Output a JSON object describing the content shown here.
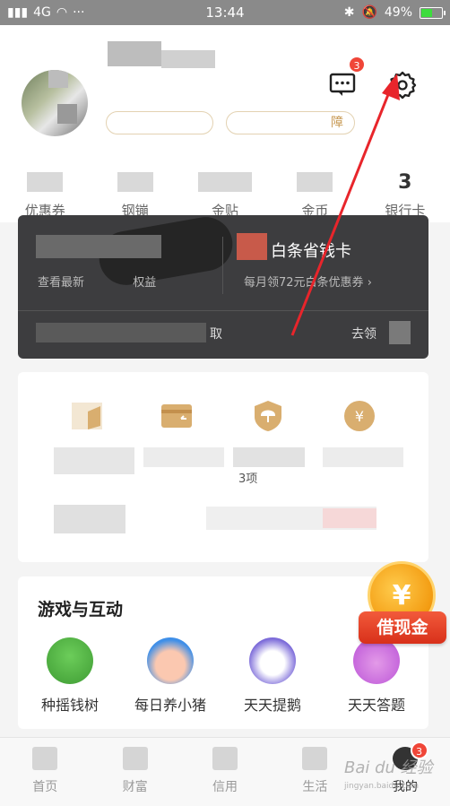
{
  "status_bar": {
    "signal": "4G",
    "more": "···",
    "time": "13:44",
    "battery": "49%",
    "battery_level": 0.49
  },
  "header": {
    "message_badge": "3",
    "assets": [
      {
        "label": "优惠券",
        "value": ""
      },
      {
        "label": "钢镚",
        "value": ""
      },
      {
        "label": "金贴",
        "value": ""
      },
      {
        "label": "金币",
        "value": ""
      },
      {
        "label": "银行卡",
        "value": "3"
      }
    ],
    "pill_right_text": "障"
  },
  "dark_card": {
    "left_sub": "查看最新",
    "left_sub_tail": "权益",
    "right_title": "白条省钱卡",
    "right_sub": "每月领72元白条优惠券",
    "right_chevron": "›",
    "bottom_text": "取",
    "go_button": "去领"
  },
  "services": {
    "items": [
      {
        "icon": "wallet-icon"
      },
      {
        "icon": "card-icon"
      },
      {
        "icon": "shield-umbrella-icon"
      },
      {
        "icon": "yen-coin-icon"
      }
    ],
    "caption_2": "3项"
  },
  "games": {
    "title": "游戏与互动",
    "items": [
      {
        "name": "种摇钱树",
        "icon": "money-tree-icon"
      },
      {
        "name": "每日养小猪",
        "icon": "pig-icon"
      },
      {
        "name": "天天提鹅",
        "icon": "goose-icon"
      },
      {
        "name": "天天答题",
        "icon": "gift-icon"
      }
    ]
  },
  "loan": {
    "label": "借现金",
    "coin": "¥"
  },
  "tabbar": {
    "tabs": [
      {
        "label": "首页"
      },
      {
        "label": "财富"
      },
      {
        "label": "信用"
      },
      {
        "label": "生活"
      },
      {
        "label": "我的",
        "badge": "3"
      }
    ]
  },
  "watermark": {
    "text": "Bai du 经验",
    "url": "jingyan.baidu.com"
  },
  "colors": {
    "accent_red": "#f04638",
    "arrow_red": "#e8252b",
    "gold": "#d8a76a"
  }
}
